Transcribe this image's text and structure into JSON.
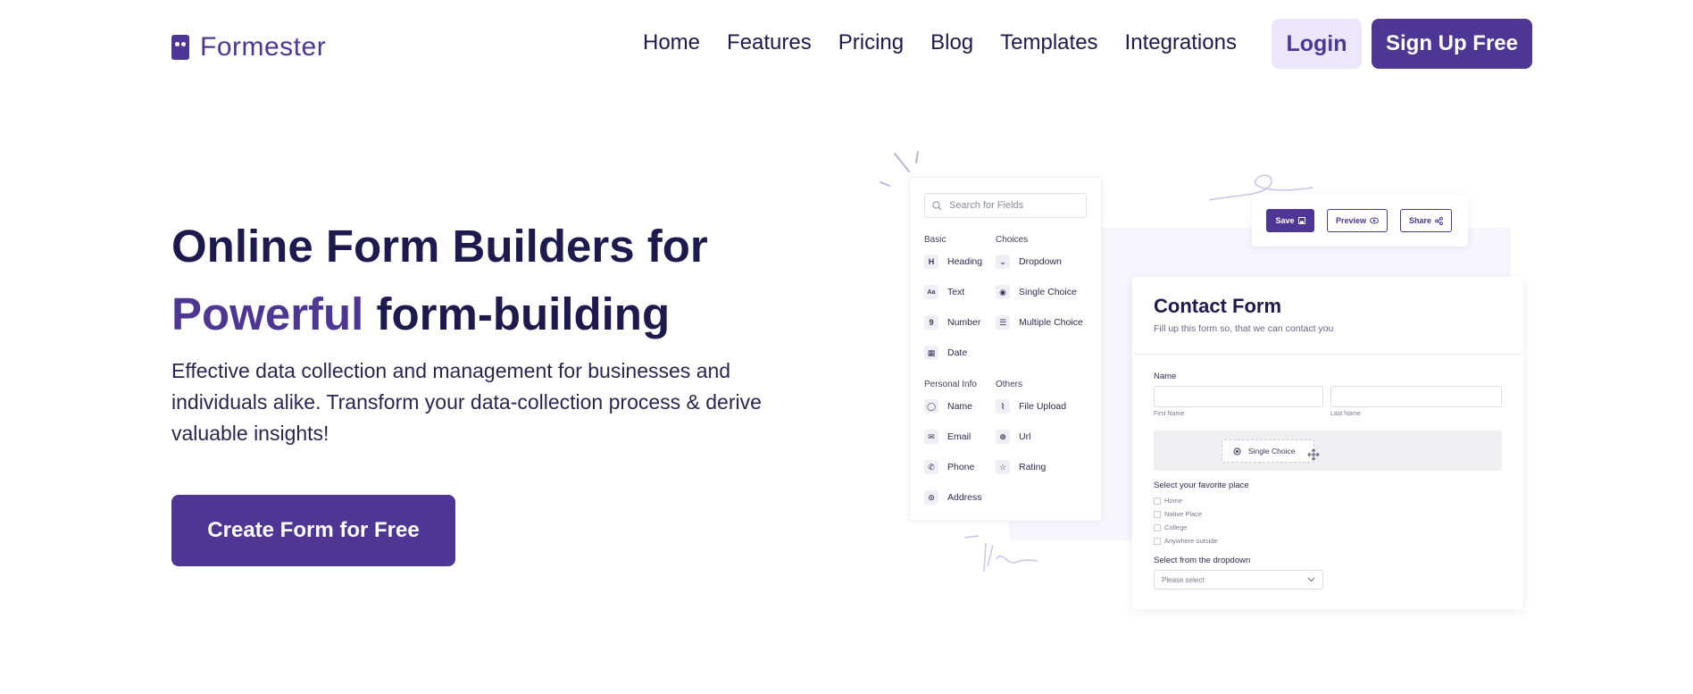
{
  "brand": {
    "name": "Formester",
    "color": "#4e3694"
  },
  "nav": {
    "links": [
      "Home",
      "Features",
      "Pricing",
      "Blog",
      "Templates",
      "Integrations"
    ],
    "login_label": "Login",
    "signup_label": "Sign Up Free"
  },
  "hero": {
    "title_line1": "Online Form Builders for",
    "title_accent": "Powerful",
    "title_rest": " form-building",
    "subtitle": "Effective data collection and management for businesses and individuals alike. Transform your data-collection process & derive valuable insights!",
    "cta_label": "Create Form for Free"
  },
  "builder": {
    "search_placeholder": "Search for Fields",
    "groups": {
      "basic": "Basic",
      "choices": "Choices",
      "personal": "Personal Info",
      "others": "Others"
    },
    "basic_fields": [
      {
        "label": "Heading",
        "icon": "heading-icon",
        "glyph": "H"
      },
      {
        "label": "Text",
        "icon": "text-icon",
        "glyph": "Aa"
      },
      {
        "label": "Number",
        "icon": "number-icon",
        "glyph": "9"
      },
      {
        "label": "Date",
        "icon": "calendar-icon",
        "glyph": "▦"
      }
    ],
    "choice_fields": [
      {
        "label": "Dropdown",
        "icon": "dropdown-icon",
        "glyph": "⌄"
      },
      {
        "label": "Single Choice",
        "icon": "radio-icon",
        "glyph": "◉"
      },
      {
        "label": "Multiple Choice",
        "icon": "list-icon",
        "glyph": "☰"
      }
    ],
    "personal_fields": [
      {
        "label": "Name",
        "icon": "user-icon",
        "glyph": "◯"
      },
      {
        "label": "Email",
        "icon": "mail-icon",
        "glyph": "✉"
      },
      {
        "label": "Phone",
        "icon": "phone-icon",
        "glyph": "✆"
      },
      {
        "label": "Address",
        "icon": "pin-icon",
        "glyph": "⊙"
      }
    ],
    "other_fields": [
      {
        "label": "File Upload",
        "icon": "paperclip-icon",
        "glyph": "⌇"
      },
      {
        "label": "Url",
        "icon": "globe-icon",
        "glyph": "⊕"
      },
      {
        "label": "Rating",
        "icon": "star-icon",
        "glyph": "☆"
      }
    ],
    "toolbar": {
      "save": "Save",
      "preview": "Preview",
      "share": "Share"
    },
    "form": {
      "title": "Contact Form",
      "subtitle": "Fill up this form so, that we can contact you",
      "name_label": "Name",
      "first_name": "First Name",
      "last_name": "Last Name",
      "drag_chip": "Single Choice",
      "place_label": "Select your favorite place",
      "places": [
        "Home",
        "Native Place",
        "College",
        "Anywhere outside"
      ],
      "dropdown_label": "Select from the dropdown",
      "dropdown_placeholder": "Please select"
    }
  }
}
